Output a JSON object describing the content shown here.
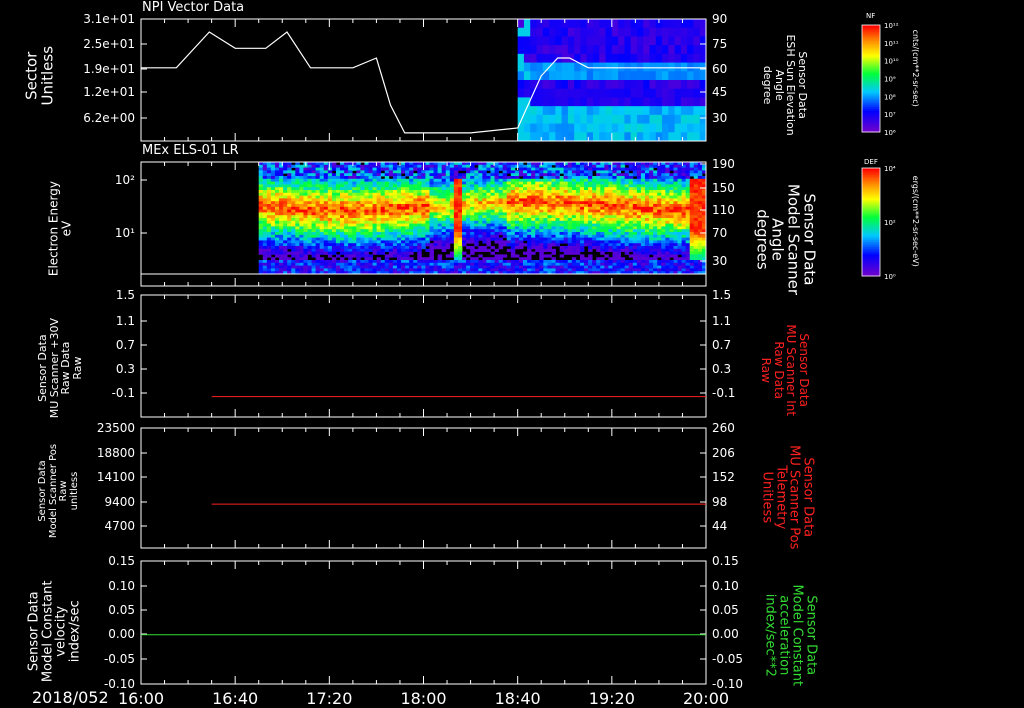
{
  "date": "2018/052",
  "x_ticks": [
    "16:00",
    "16:40",
    "17:20",
    "18:00",
    "18:40",
    "19:20",
    "20:00"
  ],
  "colors": {
    "axis": "#ffffff",
    "trace": "#ff2020",
    "green": "#33dd33"
  },
  "panels": [
    {
      "title": "NPI Vector Data",
      "left_label": [
        "Sector",
        "Unitless"
      ],
      "left_ticks": [
        "3.1e+01",
        "2.5e+01",
        "1.9e+01",
        "1.2e+01",
        "6.2e+00"
      ],
      "right_label": [
        "Sensor Data",
        "ESH Sun Elevation",
        "Angle",
        "degree"
      ],
      "right_ticks": [
        "90",
        "75",
        "60",
        "45",
        "30"
      ],
      "colorbar": {
        "title": "NF",
        "unit": "cnts/(cm**2-sr-sec)",
        "ticks": [
          "10¹²",
          "10¹¹",
          "10¹⁰",
          "10⁹",
          "10⁸",
          "10⁷",
          "10⁶"
        ]
      }
    },
    {
      "title": "MEx ELS-01 LR",
      "left_label": [
        "Electron Energy",
        "eV"
      ],
      "left_ticks": [
        "10²",
        "10¹"
      ],
      "right_label": [
        "Sensor Data",
        "Model Scanner",
        "Angle",
        "degrees"
      ],
      "right_ticks": [
        "190",
        "150",
        "110",
        "70",
        "30"
      ],
      "colorbar": {
        "title": "DEF",
        "unit": "ergs/(cm**2-sr-sec-eV)",
        "ticks": [
          "10⁴",
          "10²",
          "10⁰"
        ]
      }
    },
    {
      "left_label": [
        "Sensor Data",
        "MU Scanner +30V",
        "Raw Data",
        "Raw"
      ],
      "left_ticks": [
        "1.5",
        "1.1",
        "0.7",
        "0.3",
        "-0.1"
      ],
      "right_label": [
        "Sensor Data",
        "MU Scanner Int",
        "Raw Data",
        "Raw"
      ],
      "right_ticks": [
        "1.5",
        "1.1",
        "0.7",
        "0.3",
        "-0.1"
      ]
    },
    {
      "left_label": [
        "Sensor Data",
        "Model Scanner Pos",
        "Raw",
        "unitless"
      ],
      "left_ticks": [
        "23500",
        "18800",
        "14100",
        "9400",
        "4700"
      ],
      "right_label": [
        "Sensor Data",
        "MU Scanner Pos",
        "Telemetry",
        "Unitless"
      ],
      "right_ticks": [
        "260",
        "206",
        "152",
        "98",
        "44"
      ]
    },
    {
      "left_label": [
        "Sensor Data",
        "Model Constant",
        "velocity",
        "index/sec"
      ],
      "left_ticks": [
        "0.15",
        "0.10",
        "0.05",
        "0.00",
        "-0.05",
        "-0.10"
      ],
      "right_label": [
        "Sensor Data",
        "Model Constant",
        "acceleration",
        "index/sec**2"
      ],
      "right_ticks": [
        "0.15",
        "0.10",
        "0.05",
        "0.00",
        "-0.05",
        "-0.10"
      ]
    }
  ],
  "chart_data": [
    {
      "type": "line",
      "title": "NPI Vector Data",
      "xlabel": "",
      "ylabel": "Sector Unitless",
      "x_range": [
        "16:00",
        "20:00"
      ],
      "ylim": [
        0,
        31
      ],
      "series": [
        {
          "name": "Sensor Data ESH Sun Elevation Angle",
          "x": [
            "16:00",
            "16:15",
            "16:29",
            "16:40",
            "16:45",
            "16:53",
            "17:02",
            "17:12",
            "17:30",
            "17:40",
            "17:46",
            "17:52",
            "18:00",
            "18:20",
            "18:40",
            "18:50",
            "18:57",
            "19:02",
            "19:10",
            "20:00"
          ],
          "y": [
            60,
            60,
            82,
            72,
            72,
            72,
            82,
            60,
            60,
            66,
            37,
            20,
            20,
            20,
            23,
            55,
            66,
            66,
            60,
            60
          ]
        }
      ],
      "right_ylim": [
        15,
        90
      ]
    },
    {
      "type": "heatmap",
      "title": "MEx ELS-01 LR",
      "ylabel": "Electron Energy eV",
      "yscale": "log",
      "y_range": [
        1,
        150
      ],
      "x_data_start": "16:50",
      "peak_band_eV": 20
    },
    {
      "type": "line",
      "series": [
        {
          "name": "MU Scanner +30V",
          "x": [
            "16:30",
            "20:00"
          ],
          "y": [
            0,
            0
          ]
        }
      ],
      "ylim": [
        -0.3,
        1.5
      ]
    },
    {
      "type": "line",
      "series": [
        {
          "name": "Model Scanner Pos",
          "x": [
            "16:30",
            "20:00"
          ],
          "y": [
            8600,
            8600
          ]
        }
      ],
      "ylim": [
        0,
        23500
      ]
    },
    {
      "type": "line",
      "series": [
        {
          "name": "Model Constant velocity",
          "x": [
            "16:00",
            "20:00"
          ],
          "y": [
            0,
            0
          ]
        }
      ],
      "ylim": [
        -0.1,
        0.15
      ]
    }
  ]
}
